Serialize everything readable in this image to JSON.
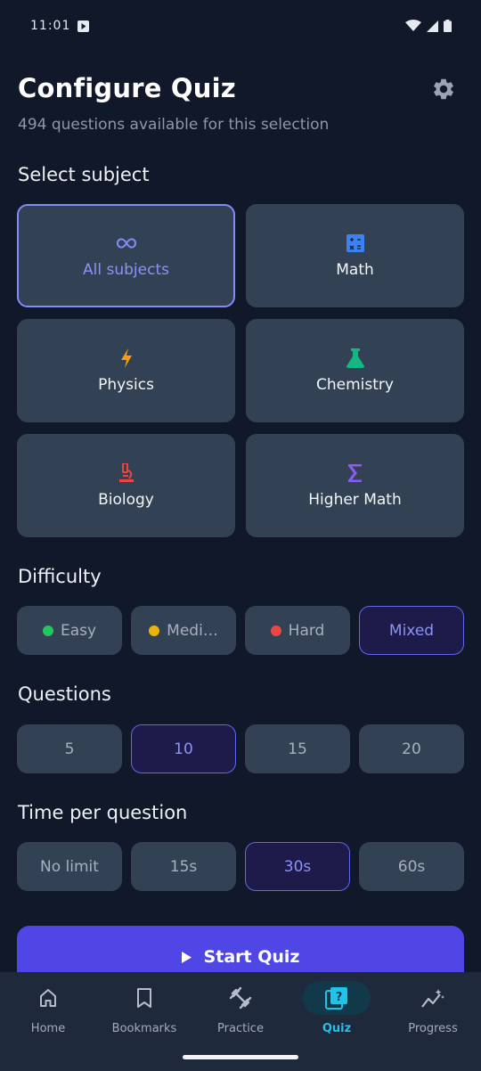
{
  "status": {
    "time": "11:01"
  },
  "header": {
    "title": "Configure Quiz",
    "subtitle": "494 questions available for this selection"
  },
  "subject_section": {
    "label": "Select subject",
    "items": [
      {
        "label": "All subjects",
        "icon": "infinity-icon",
        "color": "#818cf8",
        "selected": true
      },
      {
        "label": "Math",
        "icon": "calculator-icon",
        "color": "#3b82f6",
        "selected": false
      },
      {
        "label": "Physics",
        "icon": "lightning-icon",
        "color": "#f59e0b",
        "selected": false
      },
      {
        "label": "Chemistry",
        "icon": "flask-icon",
        "color": "#10b981",
        "selected": false
      },
      {
        "label": "Biology",
        "icon": "microscope-icon",
        "color": "#ef4444",
        "selected": false
      },
      {
        "label": "Higher Math",
        "icon": "sigma-icon",
        "color": "#8b5cf6",
        "selected": false
      }
    ]
  },
  "difficulty": {
    "label": "Difficulty",
    "options": [
      {
        "label": "Easy",
        "dot_color": "#22c55e"
      },
      {
        "label": "Medi…",
        "dot_color": "#eab308"
      },
      {
        "label": "Hard",
        "dot_color": "#ef4444"
      },
      {
        "label": "Mixed",
        "selected": true
      }
    ]
  },
  "questions": {
    "label": "Questions",
    "options": [
      "5",
      "10",
      "15",
      "20"
    ],
    "selected": "10"
  },
  "time": {
    "label": "Time per question",
    "options": [
      "No limit",
      "15s",
      "30s",
      "60s"
    ],
    "selected": "30s"
  },
  "start_button": {
    "label": "Start Quiz"
  },
  "nav": {
    "items": [
      {
        "label": "Home",
        "icon": "home-icon"
      },
      {
        "label": "Bookmarks",
        "icon": "bookmark-icon"
      },
      {
        "label": "Practice",
        "icon": "dumbbell-icon"
      },
      {
        "label": "Quiz",
        "icon": "quiz-icon",
        "active": true
      },
      {
        "label": "Progress",
        "icon": "progress-icon"
      }
    ]
  },
  "colors": {
    "background": "#101829",
    "card": "#334155",
    "accent": "#818cf8",
    "primary_button": "#4f46e5",
    "nav_active": "#22c3e8"
  }
}
